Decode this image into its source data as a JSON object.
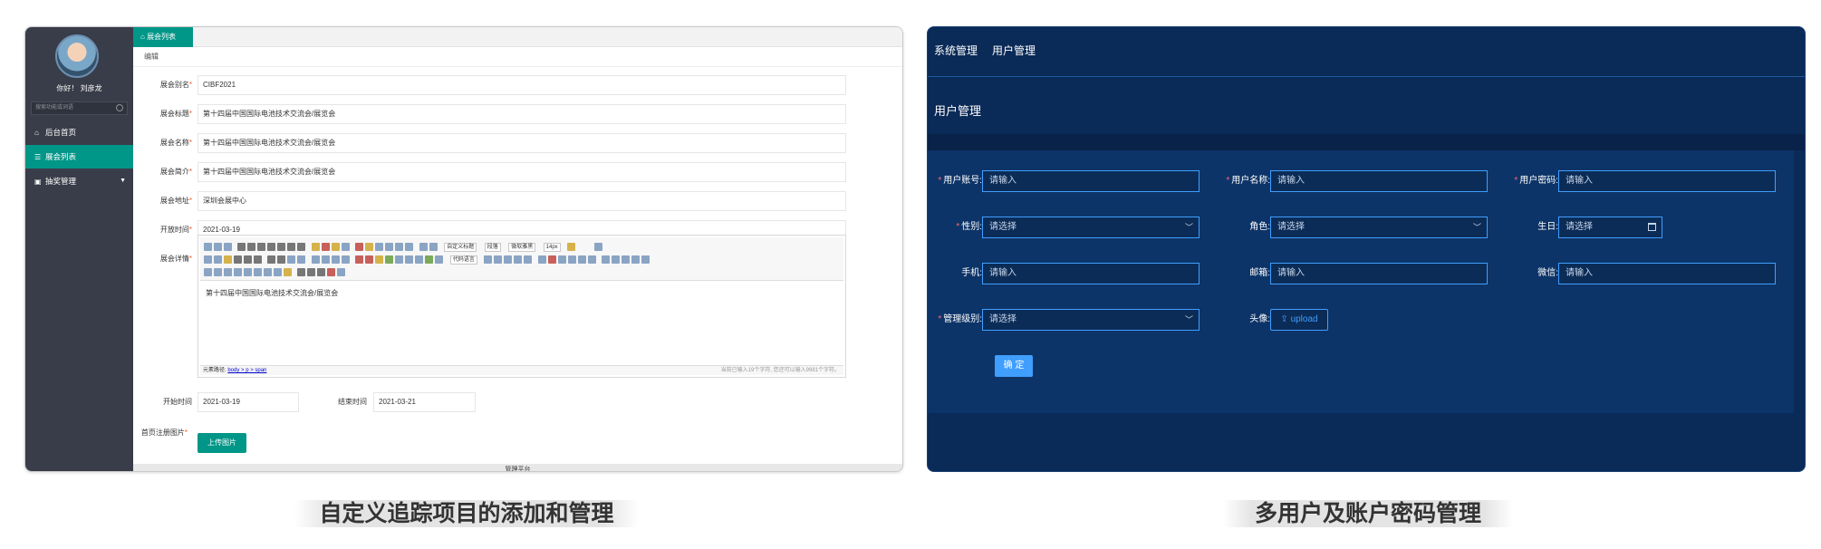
{
  "left": {
    "sidebar": {
      "greeting": "你好！ 刘彦龙",
      "search_placeholder": "搜索功能或词语",
      "items": [
        {
          "label": "后台首页",
          "icon": "home-icon"
        },
        {
          "label": "展会列表",
          "icon": "list-icon"
        },
        {
          "label": "抽奖管理",
          "icon": "lottery-icon"
        }
      ]
    },
    "tab_label": "展会列表",
    "subtab_label": "编辑",
    "fields": {
      "alias": {
        "label": "展会别名",
        "value": "CIBF2021"
      },
      "title": {
        "label": "展会标题",
        "value": "第十四届中国国际电池技术交流会/展览会"
      },
      "name": {
        "label": "展会名称",
        "value": "第十四届中国国际电池技术交流会/展览会"
      },
      "intro": {
        "label": "展会简介",
        "value": "第十四届中国国际电池技术交流会/展览会"
      },
      "address": {
        "label": "展会地址",
        "value": "深圳会展中心"
      },
      "open_time": {
        "label": "开放时间",
        "value": "2021-03-19"
      },
      "detail": {
        "label": "展会详情"
      }
    },
    "editor": {
      "font_family": "自定义标题",
      "paragraph": "段落",
      "font_name": "微软雅黑",
      "font_size": "14px",
      "code_lang": "代码语言",
      "content": "第十四届中国国际电池技术交流会/展览会",
      "status_path_label": "元素路径:",
      "status_path": "body > p > span",
      "char_count": "当前已输入19个字符, 您还可以输入9981个字符。"
    },
    "start": {
      "label": "开始时间",
      "value": "2021-03-19"
    },
    "end": {
      "label": "结束时间",
      "value": "2021-03-21"
    },
    "homepage_image": {
      "label": "首页注册图片",
      "button": "上传图片"
    },
    "footer": "管理平台"
  },
  "right": {
    "menu": [
      "系统管理",
      "用户管理"
    ],
    "title": "用户管理",
    "fields": {
      "account": {
        "label": "用户账号:",
        "placeholder": "请输入"
      },
      "username": {
        "label": "用户名称:",
        "placeholder": "请输入"
      },
      "password": {
        "label": "用户密码:",
        "placeholder": "请输入"
      },
      "gender": {
        "label": "性别:",
        "placeholder": "请选择"
      },
      "role": {
        "label": "角色:",
        "placeholder": "请选择"
      },
      "birthday": {
        "label": "生日:",
        "placeholder": "请选择"
      },
      "phone": {
        "label": "手机:",
        "placeholder": "请输入"
      },
      "email": {
        "label": "邮箱:",
        "placeholder": "请输入"
      },
      "wechat": {
        "label": "微信:",
        "placeholder": "请输入"
      },
      "level": {
        "label": "管理级别:",
        "placeholder": "请选择"
      },
      "avatar": {
        "label": "头像:",
        "button": "upload"
      }
    },
    "confirm": "确 定"
  },
  "captions": {
    "left": "自定义追踪项目的添加和管理",
    "right": "多用户及账户密码管理"
  },
  "colors": {
    "sidebar_bg": "#393d49",
    "accent_teal": "#009688",
    "right_bg": "#0a2a57",
    "right_accent": "#409eff"
  }
}
